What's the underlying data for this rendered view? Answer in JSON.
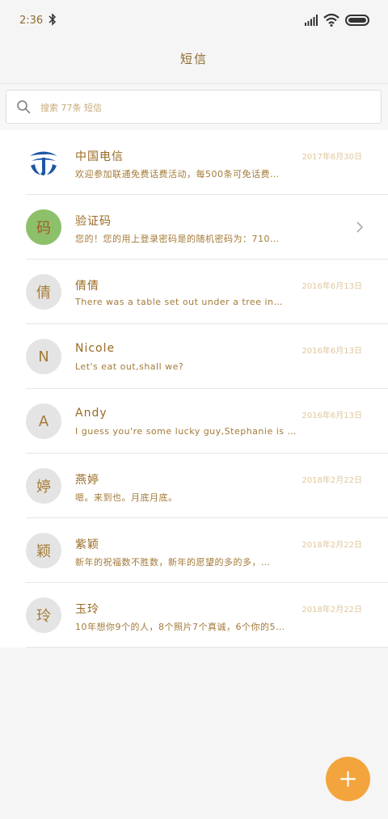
{
  "status_bar": {
    "time": "2:36"
  },
  "header": {
    "title": "短信"
  },
  "search": {
    "placeholder": "搜索 77条 短信"
  },
  "conversations": [
    {
      "avatar_text": "",
      "name": "中国电信",
      "date": "2017年6月30日",
      "preview": "欢迎参加联通免费话费活动，每500条可免话费…",
      "avatar_color": "#ffffff"
    },
    {
      "avatar_text": "码",
      "name": "验证码",
      "date": "",
      "preview": "您的！您的用上登录密码是的随机密码为：710…",
      "avatar_color": "#8dc06a"
    },
    {
      "avatar_text": "倩",
      "name": "倩倩",
      "date": "2016年6月13日",
      "preview": "There was a table set out under a tree in…",
      "avatar_color": "#e4e4e4"
    },
    {
      "avatar_text": "N",
      "name": "Nicole",
      "date": "2016年6月13日",
      "preview": "Let's eat out,shall we?",
      "avatar_color": "#e4e4e4"
    },
    {
      "avatar_text": "A",
      "name": "Andy",
      "date": "2016年6月13日",
      "preview": "I guess you're some lucky guy,Stephanie is …",
      "avatar_color": "#e4e4e4"
    },
    {
      "avatar_text": "婷",
      "name": "燕婷",
      "date": "2018年2月22日",
      "preview": "嗯。来到也。月底月底。",
      "avatar_color": "#e4e4e4"
    },
    {
      "avatar_text": "颖",
      "name": "紫颖",
      "date": "2018年2月22日",
      "preview": "新年的祝福数不胜数，新年的愿望的多的多，…",
      "avatar_color": "#e4e4e4"
    },
    {
      "avatar_text": "玲",
      "name": "玉玲",
      "date": "2018年2月22日",
      "preview": "10年想你9个的人，8个照片7个真诚，6个你的5…",
      "avatar_color": "#e4e4e4"
    }
  ],
  "fab": {
    "label": "+"
  }
}
